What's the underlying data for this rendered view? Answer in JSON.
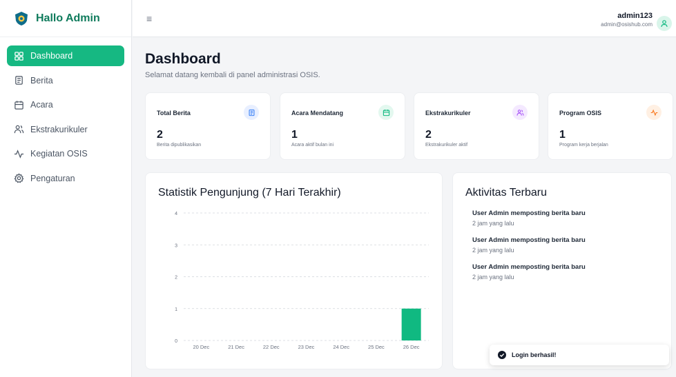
{
  "brand": {
    "title": "Hallo Admin"
  },
  "sidebar": {
    "items": [
      {
        "label": "Dashboard",
        "icon": "dashboard-grid-icon",
        "active": true
      },
      {
        "label": "Berita",
        "icon": "newspaper-icon"
      },
      {
        "label": "Acara",
        "icon": "calendar-icon"
      },
      {
        "label": "Ekstrakurikuler",
        "icon": "users-icon"
      },
      {
        "label": "Kegiatan OSIS",
        "icon": "activity-icon"
      },
      {
        "label": "Pengaturan",
        "icon": "gear-icon"
      }
    ]
  },
  "topbar": {
    "menu_glyph": "≡",
    "user_name": "admin123",
    "user_email": "admin@osishub.com"
  },
  "page": {
    "title": "Dashboard",
    "subtitle": "Selamat datang kembali di panel administrasi OSIS."
  },
  "stats": [
    {
      "label": "Total Berita",
      "value": "2",
      "desc": "Berita dipublikasikan",
      "icon": "newspaper-icon",
      "color": "#3b82f6",
      "bg": "#e8efff"
    },
    {
      "label": "Acara Mendatang",
      "value": "1",
      "desc": "Acara aktif bulan ini",
      "icon": "calendar-icon",
      "color": "#10b981",
      "bg": "#e3f8ef"
    },
    {
      "label": "Ekstrakurikuler",
      "value": "2",
      "desc": "Ekstrakurikuler aktif",
      "icon": "users-icon",
      "color": "#a855f7",
      "bg": "#f4e9ff"
    },
    {
      "label": "Program OSIS",
      "value": "1",
      "desc": "Program kerja berjalan",
      "icon": "activity-icon",
      "color": "#f97316",
      "bg": "#fff0e3"
    }
  ],
  "chart_panel": {
    "title": "Statistik Pengunjung (7 Hari Terakhir)"
  },
  "chart_data": {
    "type": "bar",
    "categories": [
      "20 Dec",
      "21 Dec",
      "22 Dec",
      "23 Dec",
      "24 Dec",
      "25 Dec",
      "26 Dec"
    ],
    "values": [
      0,
      0,
      0,
      0,
      0,
      0,
      1
    ],
    "yticks": [
      "0",
      "1",
      "2",
      "3",
      "4"
    ],
    "ylim": [
      0,
      4
    ],
    "grid": true,
    "color": "#10b981"
  },
  "activity": {
    "title": "Aktivitas Terbaru",
    "items": [
      {
        "title": "User Admin memposting berita baru",
        "time": "2 jam yang lalu"
      },
      {
        "title": "User Admin memposting berita baru",
        "time": "2 jam yang lalu"
      },
      {
        "title": "User Admin memposting berita baru",
        "time": "2 jam yang lalu"
      }
    ]
  },
  "toast": {
    "text": "Login berhasil!",
    "icon": "check-circle-icon"
  },
  "colors": {
    "accent": "#16b882",
    "brand": "#0f7b5c"
  }
}
